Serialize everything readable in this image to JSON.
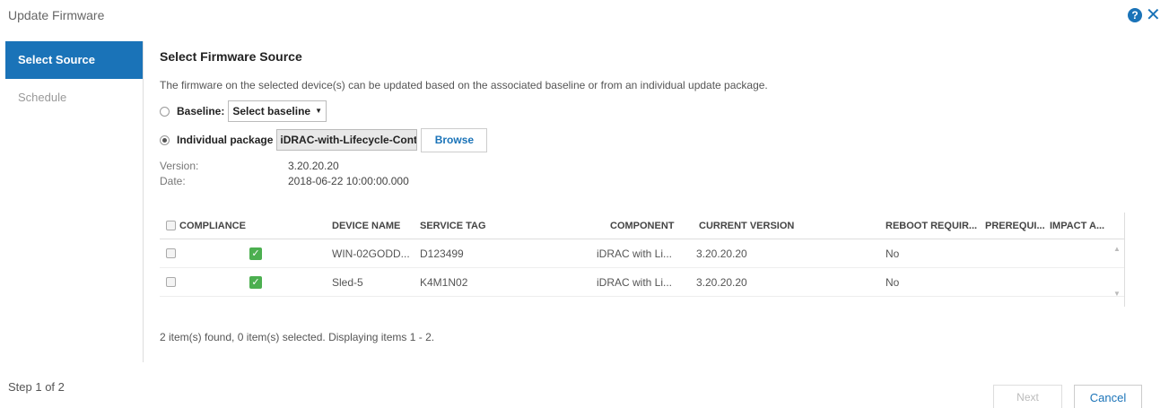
{
  "dialog": {
    "title": "Update Firmware",
    "help_icon": "?",
    "close_icon": "✕"
  },
  "sidebar": {
    "items": [
      {
        "label": "Select Source",
        "active": true
      },
      {
        "label": "Schedule",
        "active": false
      }
    ]
  },
  "main": {
    "section_title": "Select Firmware Source",
    "description": "The firmware on the selected device(s) can be updated based on the associated baseline or from an individual update package.",
    "baseline": {
      "label": "Baseline:",
      "select_value": "Select baseline",
      "checked": false
    },
    "package": {
      "label": "Individual package",
      "input_value": "iDRAC-with-Lifecycle-Controller",
      "browse_label": "Browse",
      "checked": true
    },
    "meta": {
      "version_label": "Version:",
      "version_value": "3.20.20.20",
      "date_label": "Date:",
      "date_value": "2018-06-22 10:00:00.000"
    }
  },
  "grid": {
    "columns": {
      "compliance": "COMPLIANCE",
      "device_name": "DEVICE NAME",
      "service_tag": "SERVICE TAG",
      "component": "COMPONENT",
      "current_version": "CURRENT VERSION",
      "reboot_required": "REBOOT REQUIR...",
      "prerequisites": "PREREQUI...",
      "impact": "IMPACT A..."
    },
    "rows": [
      {
        "device_name": "WIN-02GODD...",
        "service_tag": "D123499",
        "component": "iDRAC with Li...",
        "current_version": "3.20.20.20",
        "reboot_required": "No"
      },
      {
        "device_name": "Sled-5",
        "service_tag": "K4M1N02",
        "component": "iDRAC with Li...",
        "current_version": "3.20.20.20",
        "reboot_required": "No"
      }
    ]
  },
  "summary": "2 item(s) found, 0 item(s) selected. Displaying items 1 - 2.",
  "footer": {
    "step": "Step 1 of 2",
    "next_label": "Next",
    "cancel_label": "Cancel"
  },
  "colors": {
    "accent": "#1a73b8",
    "compliance_ok": "#4caf50"
  }
}
